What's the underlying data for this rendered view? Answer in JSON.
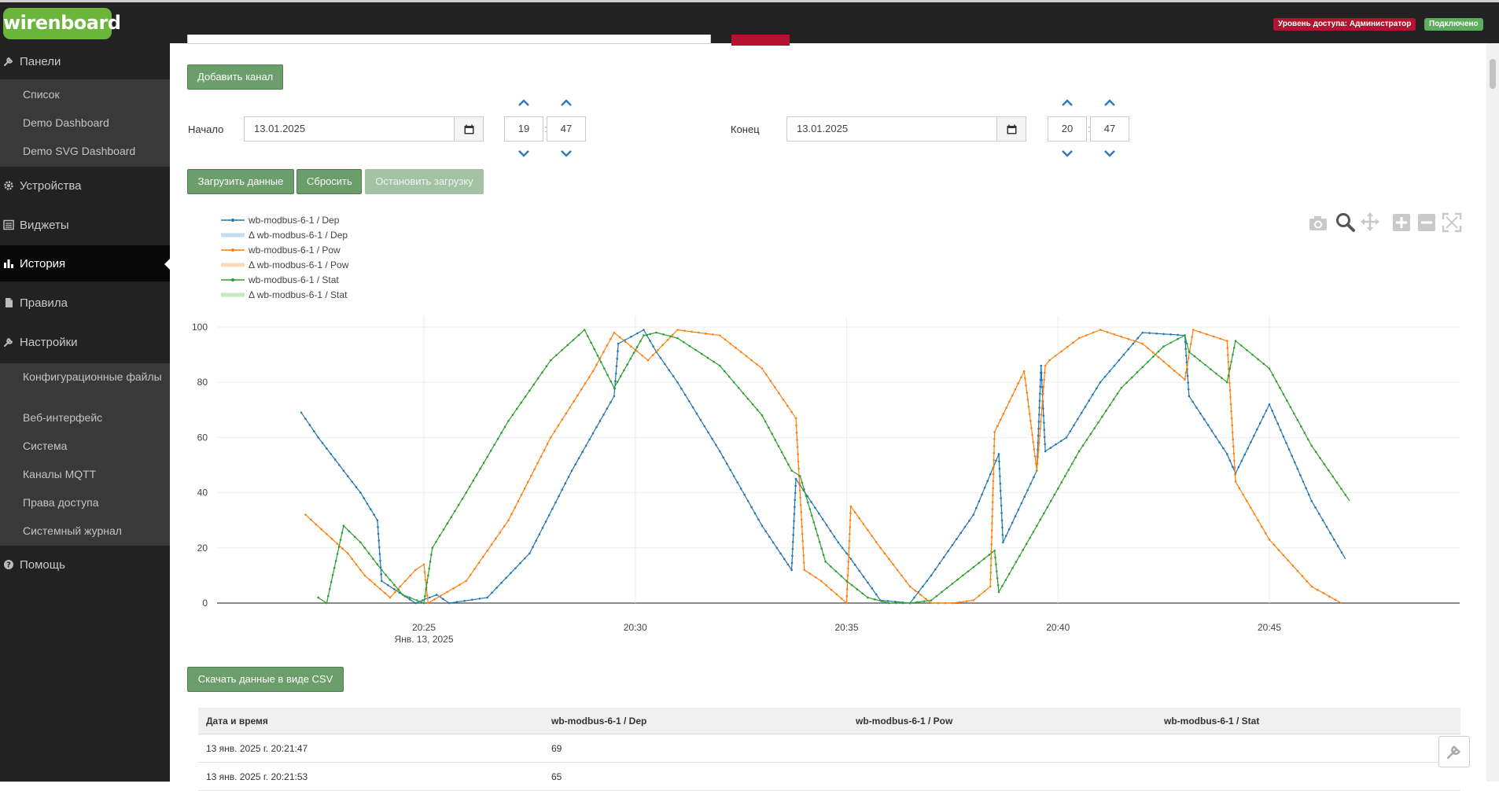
{
  "header": {
    "logo": "wirenboard",
    "access_badge": "Уровень доступа: Администратор",
    "connection_badge": "Подключено",
    "colors": {
      "bar": "#222222",
      "logo": "#6ab53a",
      "access": "#b5122f",
      "connected": "#5cad5c"
    }
  },
  "sidebar": {
    "panels": "Панели",
    "panels_sub": [
      "Список",
      "Demo Dashboard",
      "Demo SVG Dashboard"
    ],
    "devices": "Устройства",
    "widgets": "Виджеты",
    "history": "История",
    "rules": "Правила",
    "settings": "Настройки",
    "settings_sub": [
      "Конфигурационные файлы",
      "Веб-интерфейс",
      "Система",
      "Каналы MQTT",
      "Права доступа",
      "Системный журнал"
    ],
    "help": "Помощь",
    "icons": {
      "panels": "wrench-icon",
      "devices": "gear-icon",
      "widgets": "list-icon",
      "history": "bar-chart-icon",
      "rules": "file-icon",
      "settings": "wrench-icon",
      "help": "question-circle-icon"
    }
  },
  "controls": {
    "add_channel": "Добавить канал",
    "start_label": "Начало",
    "start_date": "13.01.2025",
    "start_hour": "19",
    "start_minute": "47",
    "end_label": "Конец",
    "end_date": "13.01.2025",
    "end_hour": "20",
    "end_minute": "47",
    "load": "Загрузить данные",
    "reset": "Сбросить",
    "stop": "Остановить загрузку",
    "download_csv": "Скачать данные в виде CSV"
  },
  "chart_data": {
    "type": "line",
    "title": "",
    "xlabel": "",
    "ylabel": "",
    "x_ticks": [
      "20:25",
      "20:30",
      "20:35",
      "20:40",
      "20:45"
    ],
    "x_tick_minutes": [
      25,
      30,
      35,
      40,
      45
    ],
    "x_sublabel": "Янв. 13, 2025",
    "xlim": [
      20.4,
      46.9
    ],
    "ylim": [
      0,
      100
    ],
    "y_ticks": [
      0,
      20,
      40,
      60,
      80,
      100
    ],
    "grid": true,
    "legend_position": "top-left",
    "legend": [
      {
        "name": "wb-modbus-6-1 / Dep",
        "color": "#1f77b4",
        "kind": "line"
      },
      {
        "name": "Δ wb-modbus-6-1 / Dep",
        "color": "#c6dbef",
        "kind": "band"
      },
      {
        "name": "wb-modbus-6-1 / Pow",
        "color": "#ff7f0e",
        "kind": "line"
      },
      {
        "name": "Δ wb-modbus-6-1 / Pow",
        "color": "#fdd9b5",
        "kind": "band"
      },
      {
        "name": "wb-modbus-6-1 / Stat",
        "color": "#2ca02c",
        "kind": "line"
      },
      {
        "name": "Δ wb-modbus-6-1 / Stat",
        "color": "#c7e9c0",
        "kind": "band"
      }
    ],
    "series": [
      {
        "name": "wb-modbus-6-1 / Dep",
        "color": "#1f77b4",
        "x": [
          22.1,
          22.5,
          23.0,
          23.5,
          23.9,
          24.0,
          24.3,
          24.8,
          25.3,
          25.6,
          26.5,
          27.5,
          28.5,
          29.5,
          29.6,
          30.2,
          30.5,
          31.0,
          32.0,
          33.0,
          33.7,
          33.8,
          34.8,
          35.1,
          35.8,
          36.5,
          37.0,
          38.0,
          38.6,
          38.7,
          39.5,
          39.6,
          39.7,
          40.2,
          41.0,
          42.0,
          43.0,
          43.1,
          44.0,
          44.2,
          45.0,
          46.0,
          46.8
        ],
        "y": [
          69,
          60,
          50,
          40,
          30,
          8,
          5,
          0,
          3,
          0,
          2,
          18,
          48,
          75,
          94,
          99,
          91,
          80,
          55,
          28,
          12,
          45,
          22,
          16,
          1,
          0,
          10,
          32,
          54,
          22,
          48,
          86,
          55,
          60,
          80,
          98,
          97,
          75,
          54,
          47,
          72,
          37,
          16
        ]
      },
      {
        "name": "wb-modbus-6-1 / Pow",
        "color": "#ff7f0e",
        "x": [
          22.2,
          22.7,
          23.2,
          23.6,
          24.2,
          24.8,
          25.0,
          25.1,
          26.0,
          27.0,
          28.0,
          29.0,
          29.5,
          30.3,
          31.0,
          32.0,
          33.0,
          33.8,
          34.0,
          34.4,
          35.0,
          35.1,
          35.8,
          36.5,
          37.0,
          37.5,
          38.0,
          38.4,
          38.5,
          39.2,
          39.5,
          39.7,
          39.8,
          40.5,
          41.0,
          42.0,
          43.0,
          43.2,
          44.0,
          44.2,
          45.0,
          46.0,
          46.7
        ],
        "y": [
          32,
          25,
          18,
          10,
          2,
          12,
          14,
          0,
          8,
          30,
          60,
          84,
          98,
          88,
          99,
          97,
          85,
          67,
          12,
          8,
          0,
          35,
          20,
          6,
          0,
          0,
          1,
          6,
          62,
          84,
          48,
          86,
          88,
          96,
          99,
          94,
          81,
          99,
          95,
          44,
          23,
          6,
          0
        ]
      },
      {
        "name": "wb-modbus-6-1 / Stat",
        "color": "#2ca02c",
        "x": [
          22.5,
          22.7,
          23.1,
          23.5,
          24.0,
          24.5,
          25.0,
          25.2,
          26.0,
          27.0,
          28.0,
          28.8,
          29.5,
          30.2,
          30.5,
          31.0,
          32.0,
          33.0,
          33.7,
          33.9,
          34.5,
          35.0,
          35.5,
          36.0,
          36.5,
          37.0,
          38.0,
          38.5,
          38.6,
          39.5,
          40.5,
          41.5,
          42.5,
          43.0,
          43.1,
          44.0,
          44.2,
          45.0,
          46.0,
          46.9
        ],
        "y": [
          2,
          0,
          28,
          22,
          12,
          3,
          0,
          20,
          40,
          66,
          88,
          99,
          78,
          97,
          98,
          96,
          86,
          68,
          48,
          46,
          15,
          8,
          2,
          0,
          0,
          1,
          13,
          19,
          4,
          28,
          55,
          78,
          93,
          97,
          91,
          80,
          95,
          85,
          57,
          37
        ]
      }
    ]
  },
  "table": {
    "headers": [
      "Дата и время",
      "wb-modbus-6-1 / Dep",
      "wb-modbus-6-1 / Pow",
      "wb-modbus-6-1 / Stat"
    ],
    "rows": [
      [
        "13 янв. 2025 г. 20:21:47",
        "69",
        "",
        ""
      ],
      [
        "13 янв. 2025 г. 20:21:53",
        "65",
        "",
        ""
      ]
    ]
  }
}
